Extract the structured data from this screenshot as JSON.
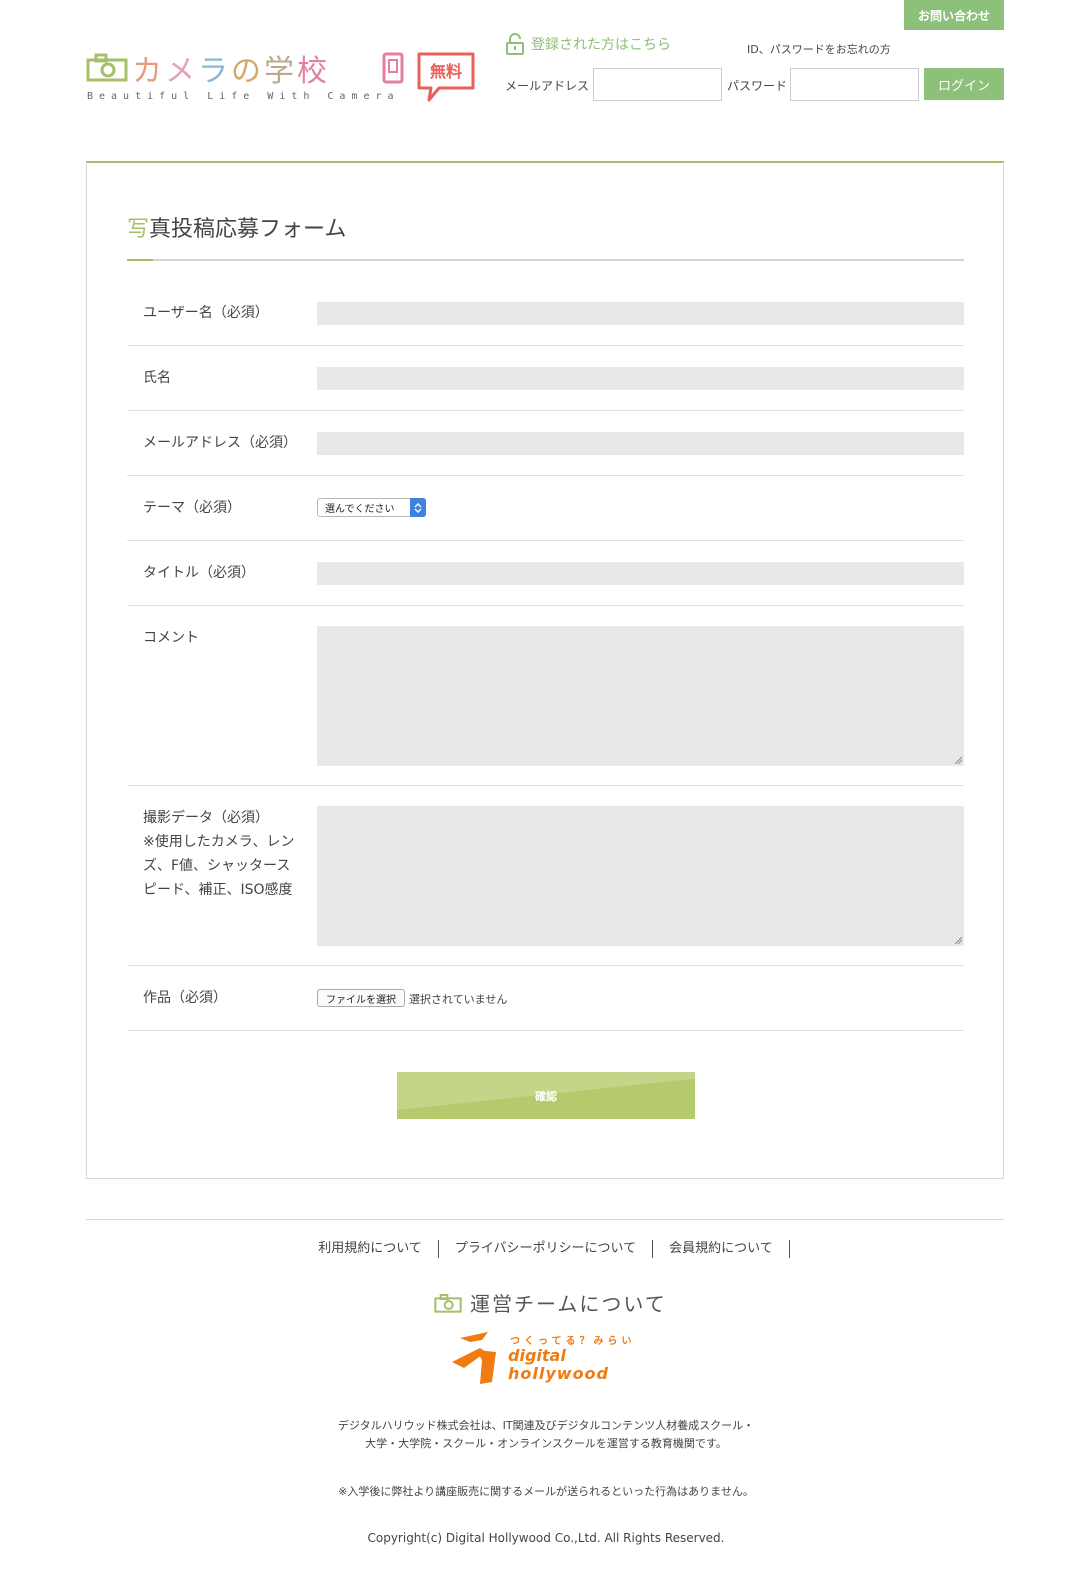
{
  "header": {
    "contact_label": "お問い合わせ",
    "logo": {
      "title_chars": [
        "カ",
        "メ",
        "ラ",
        "の",
        "学",
        "校"
      ],
      "subtitle": "Beautiful Life With Camera",
      "free_badge": "無料"
    },
    "registered_link": "登録された方はこちら",
    "forgot_link": "ID、パスワードをお忘れの方",
    "email_label": "メールアドレス",
    "password_label": "パスワード",
    "login_label": "ログイン",
    "icons": {
      "camera": "camera-icon",
      "lock": "unlock-icon",
      "phone": "smartphone-icon"
    }
  },
  "form": {
    "title_first": "写",
    "title_rest": "真投稿応募フォーム",
    "rows": [
      {
        "label": "ユーザー名（必須）"
      },
      {
        "label": "氏名"
      },
      {
        "label": "メールアドレス（必須）"
      },
      {
        "label": "テーマ（必須）",
        "select_value": "選んでください"
      },
      {
        "label": "タイトル（必須）"
      },
      {
        "label": "コメント"
      },
      {
        "label_lines": [
          "撮影データ（必須）",
          "※使用したカメラ、レン",
          "ズ、F値、シャッタース",
          "ピード、補正、ISO感度"
        ]
      },
      {
        "label": "作品（必須）",
        "file_button": "ファイルを選択",
        "file_status": "選択されていません"
      }
    ],
    "confirm_label": "確認"
  },
  "footer": {
    "links": [
      "利用規約について",
      "プライバシーポリシーについて",
      "会員規約について"
    ],
    "team_title": "運営チームについて",
    "dh_logo": {
      "tagline": "つくってる？みらい",
      "name_line1": "digital",
      "name_line2": "hollywood"
    },
    "about_line1": "デジタルハリウッド株式会社は、IT関連及びデジタルコンテンツ人材養成スクール・",
    "about_line2": "大学・大学院・スクール・オンラインスクールを運営する教育機関です。",
    "notice": "※入学後に弊社より講座販売に関するメールが送られるといった行為はありません。",
    "copyright": "Copyright(c) Digital Hollywood Co.,Ltd. All Rights Reserved."
  },
  "colors": {
    "accent_green": "#8dc07a",
    "title_green": "#a6c06a",
    "confirm_green": "#b5ca6c",
    "free_red": "#e8605a",
    "dh_orange": "#f07b10"
  }
}
